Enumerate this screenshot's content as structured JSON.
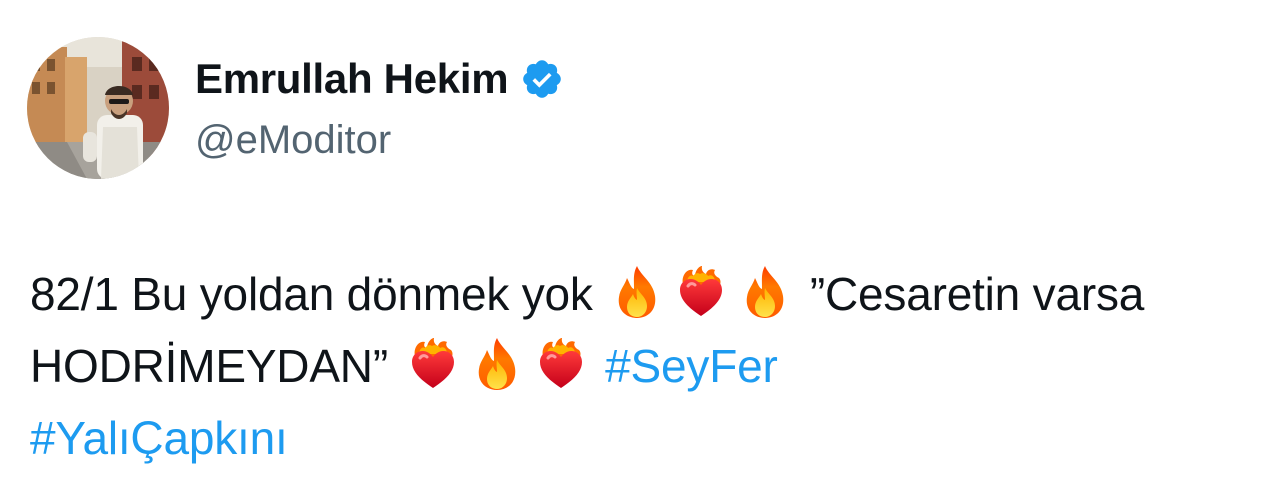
{
  "author": {
    "display_name": "Emrullah Hekim",
    "handle": "@eModitor",
    "verified": true,
    "verified_color": "#1d9bf0"
  },
  "tweet": {
    "text_part1": "82/1 Bu yoldan dönmek yok",
    "text_part2": " ”Cesaretin varsa HODRİMEYDAN”",
    "hashtag1": "#SeyFer",
    "hashtag2": "#YalıÇapkını",
    "emojis": [
      "fire",
      "heart-on-fire",
      "fire",
      "heart-on-fire",
      "fire",
      "heart-on-fire"
    ]
  },
  "colors": {
    "text": "#0f1419",
    "secondary": "#536471",
    "link": "#1d9bf0"
  }
}
